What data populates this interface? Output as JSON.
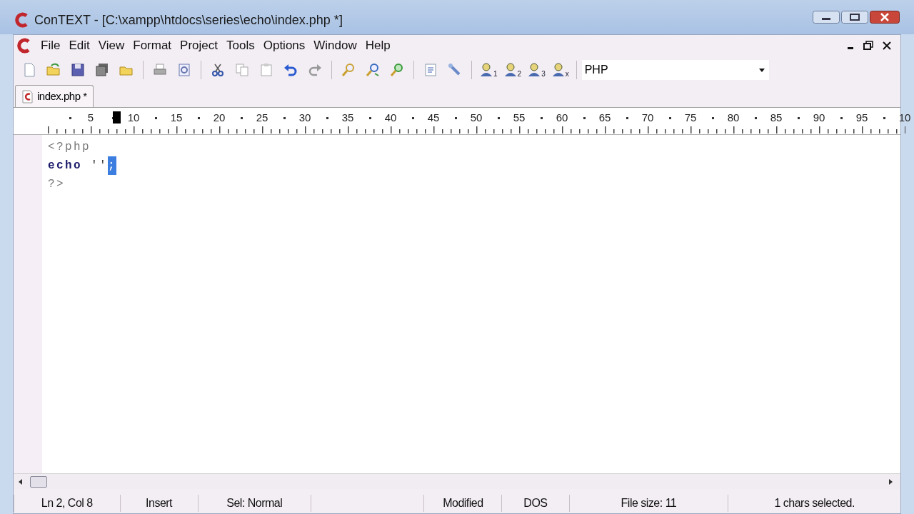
{
  "window": {
    "title": "ConTEXT - [C:\\xampp\\htdocs\\series\\echo\\index.php *]"
  },
  "menu": [
    "File",
    "Edit",
    "View",
    "Format",
    "Project",
    "Tools",
    "Options",
    "Window",
    "Help"
  ],
  "toolbar": {
    "user_tools": [
      "1",
      "2",
      "3",
      "x"
    ],
    "language": "PHP"
  },
  "tabs": [
    {
      "label": "index.php *",
      "selected": true
    }
  ],
  "ruler": {
    "labels": [
      "5",
      "10",
      "15",
      "20",
      "25",
      "30",
      "35",
      "40",
      "45",
      "50",
      "55",
      "60",
      "65",
      "70",
      "75",
      "80",
      "85",
      "90",
      "95",
      "10"
    ],
    "caret": {
      "level": 0.08
    }
  },
  "editor": {
    "lines": [
      [
        {
          "text": "<?php",
          "kind": "tag",
          "selected": false
        }
      ],
      [
        {
          "text": "echo",
          "kind": "keyword",
          "selected": false
        },
        {
          "text": " ''",
          "kind": "string",
          "selected": false
        },
        {
          "text": ";",
          "kind": "plain",
          "selected": true
        }
      ],
      [
        {
          "text": "?>",
          "kind": "tag",
          "selected": false
        }
      ]
    ]
  },
  "status_bar": [
    "Ln 2, Col 8",
    "Insert",
    "Sel: Normal",
    "Modified",
    "DOS",
    "File size: 11",
    "1 chars selected."
  ]
}
